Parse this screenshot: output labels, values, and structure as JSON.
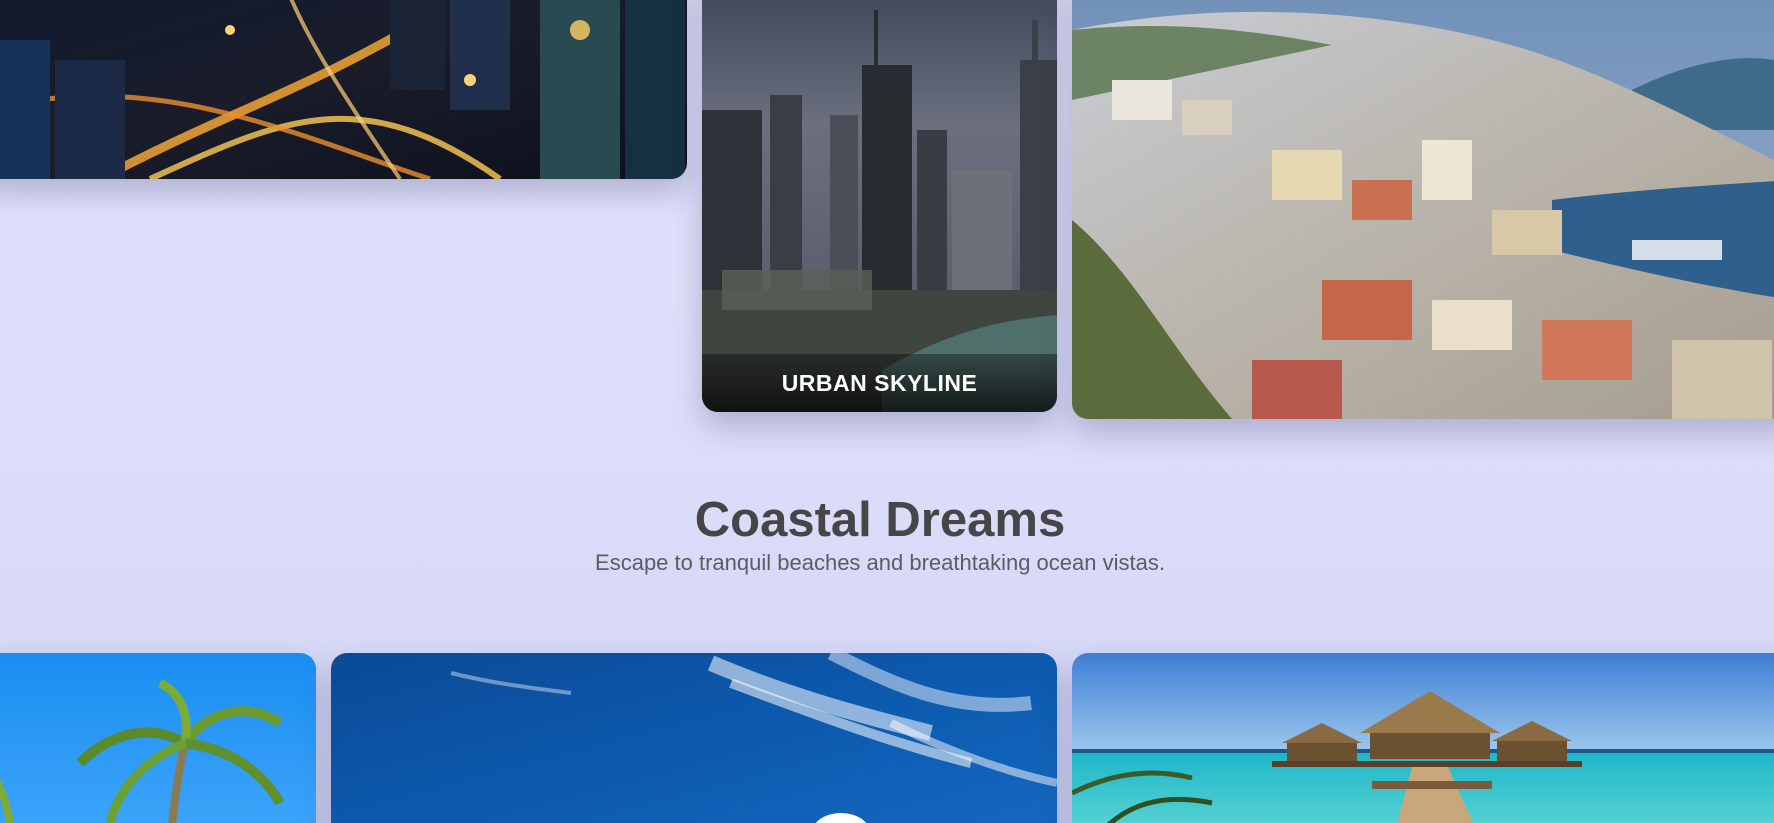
{
  "gallery": {
    "cards": {
      "city_night": {
        "alt": "city night lights"
      },
      "urban_skyline": {
        "caption": "URBAN SKYLINE"
      },
      "hillside_coast": {
        "alt": "hillside coastal town"
      },
      "palm": {
        "alt": "palm tree"
      },
      "sky": {
        "alt": "blue sky with clouds"
      },
      "maldives": {
        "alt": "overwater bungalows"
      }
    }
  },
  "section": {
    "title": "Coastal Dreams",
    "subtitle": "Escape to tranquil beaches and breathtaking ocean vistas."
  },
  "colors": {
    "background": "#dedff9",
    "title": "#464649",
    "subtitle": "#5c5d62",
    "caption_text": "#ffffff"
  }
}
